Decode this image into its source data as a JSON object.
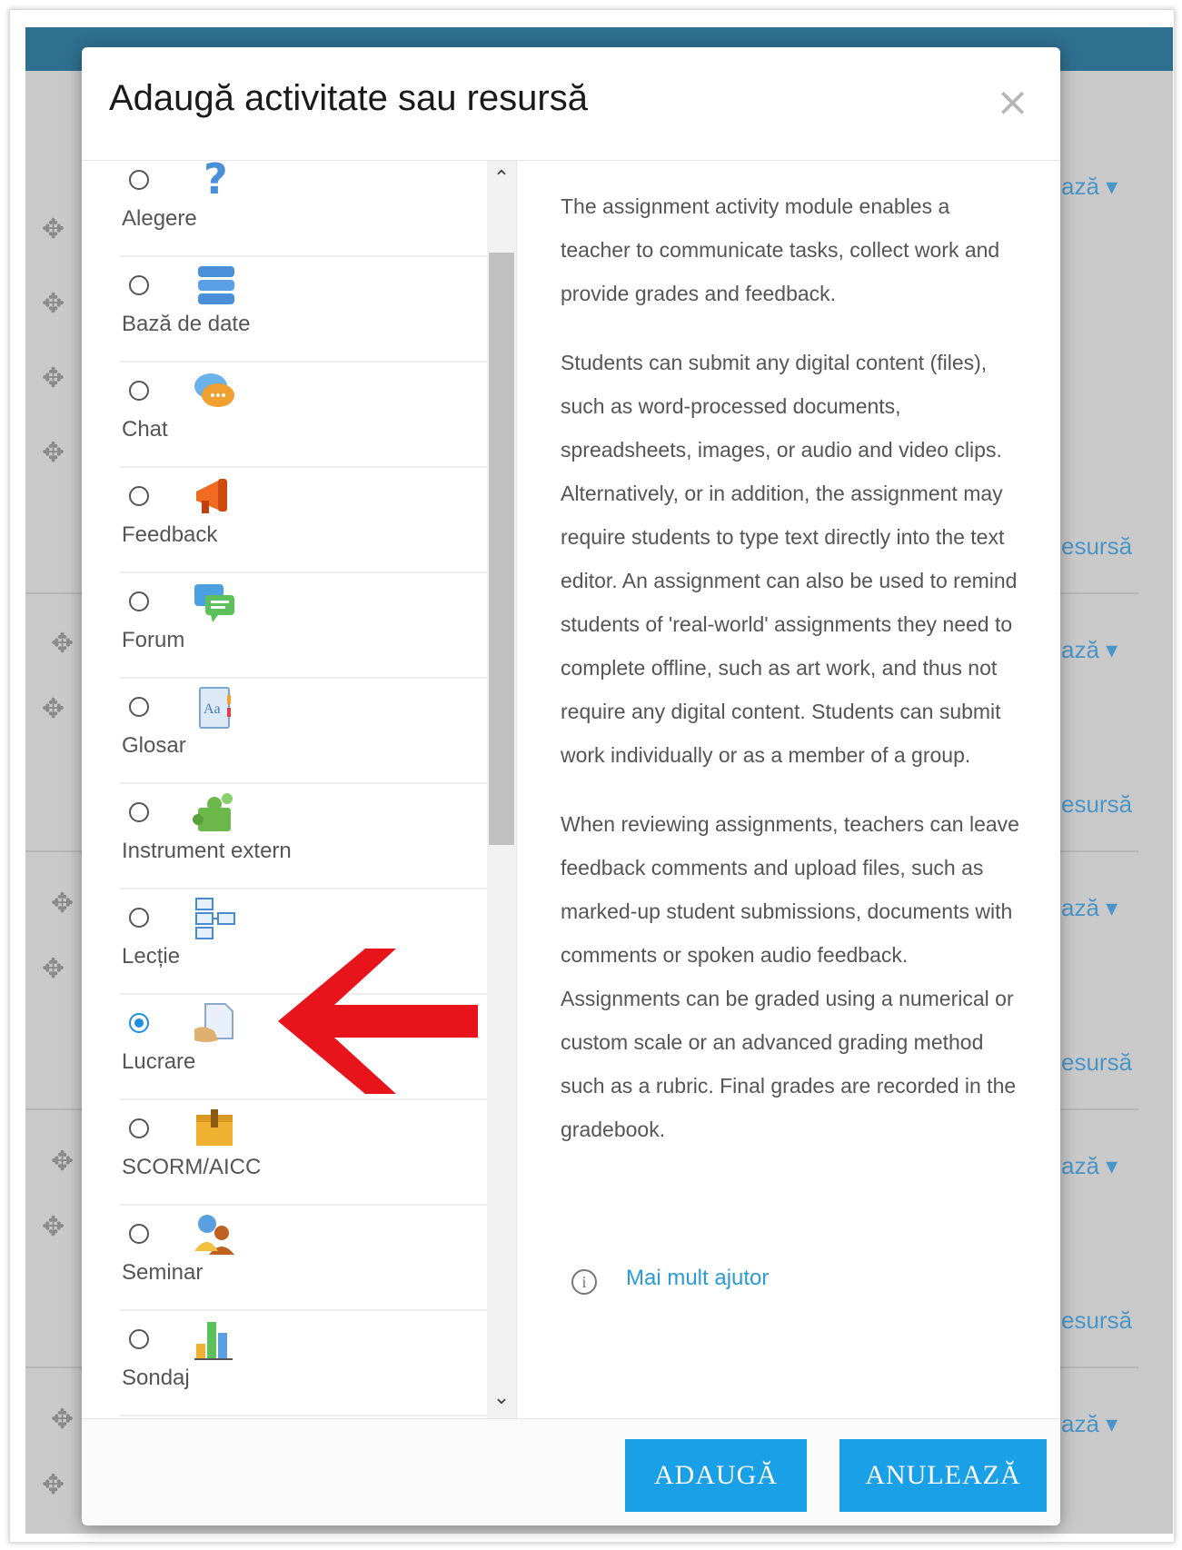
{
  "dialog": {
    "title": "Adaugă activitate sau resursă",
    "close_symbol": "×"
  },
  "activities": [
    {
      "label": "Alegere",
      "icon": "choice-question-icon",
      "selected": false
    },
    {
      "label": "Bază de date",
      "icon": "database-icon",
      "selected": false
    },
    {
      "label": "Chat",
      "icon": "chat-bubbles-icon",
      "selected": false
    },
    {
      "label": "Feedback",
      "icon": "megaphone-icon",
      "selected": false
    },
    {
      "label": "Forum",
      "icon": "forum-icon",
      "selected": false
    },
    {
      "label": "Glosar",
      "icon": "glossary-icon",
      "selected": false
    },
    {
      "label": "Instrument extern",
      "icon": "puzzle-icon",
      "selected": false
    },
    {
      "label": "Lecție",
      "icon": "lesson-flow-icon",
      "selected": false
    },
    {
      "label": "Lucrare",
      "icon": "assignment-icon",
      "selected": true
    },
    {
      "label": "SCORM/AICC",
      "icon": "package-icon",
      "selected": false
    },
    {
      "label": "Seminar",
      "icon": "workshop-icon",
      "selected": false
    },
    {
      "label": "Sondaj",
      "icon": "survey-chart-icon",
      "selected": false
    }
  ],
  "description": {
    "paragraphs": [
      "The assignment activity module enables a teacher to communicate tasks, collect work and provide grades and feedback.",
      "Students can submit any digital content (files), such as word-processed documents, spreadsheets, images, or audio and video clips. Alternatively, or in addition, the assignment may require students to type text directly into the text editor. An assignment can also be used to remind students of 'real-world' assignments they need to complete offline, such as art work, and thus not require any digital content. Students can submit work individually or as a member of a group.",
      "When reviewing assignments, teachers can leave feedback comments and upload files, such as marked-up student submissions, documents with comments or spoken audio feedback. Assignments can be graded using a numerical or custom scale or an advanced grading method such as a rubric. Final grades are recorded in the gradebook."
    ],
    "help_link": "Mai mult ajutor"
  },
  "footer": {
    "add_label": "ADAUGĂ",
    "cancel_label": "ANULEAZĂ"
  },
  "background": {
    "link_a": "ază ▾",
    "link_b": "esursă"
  },
  "colors": {
    "accent": "#1aa0e6",
    "topbar": "#2f6f8f",
    "arrow": "#e8141b"
  }
}
